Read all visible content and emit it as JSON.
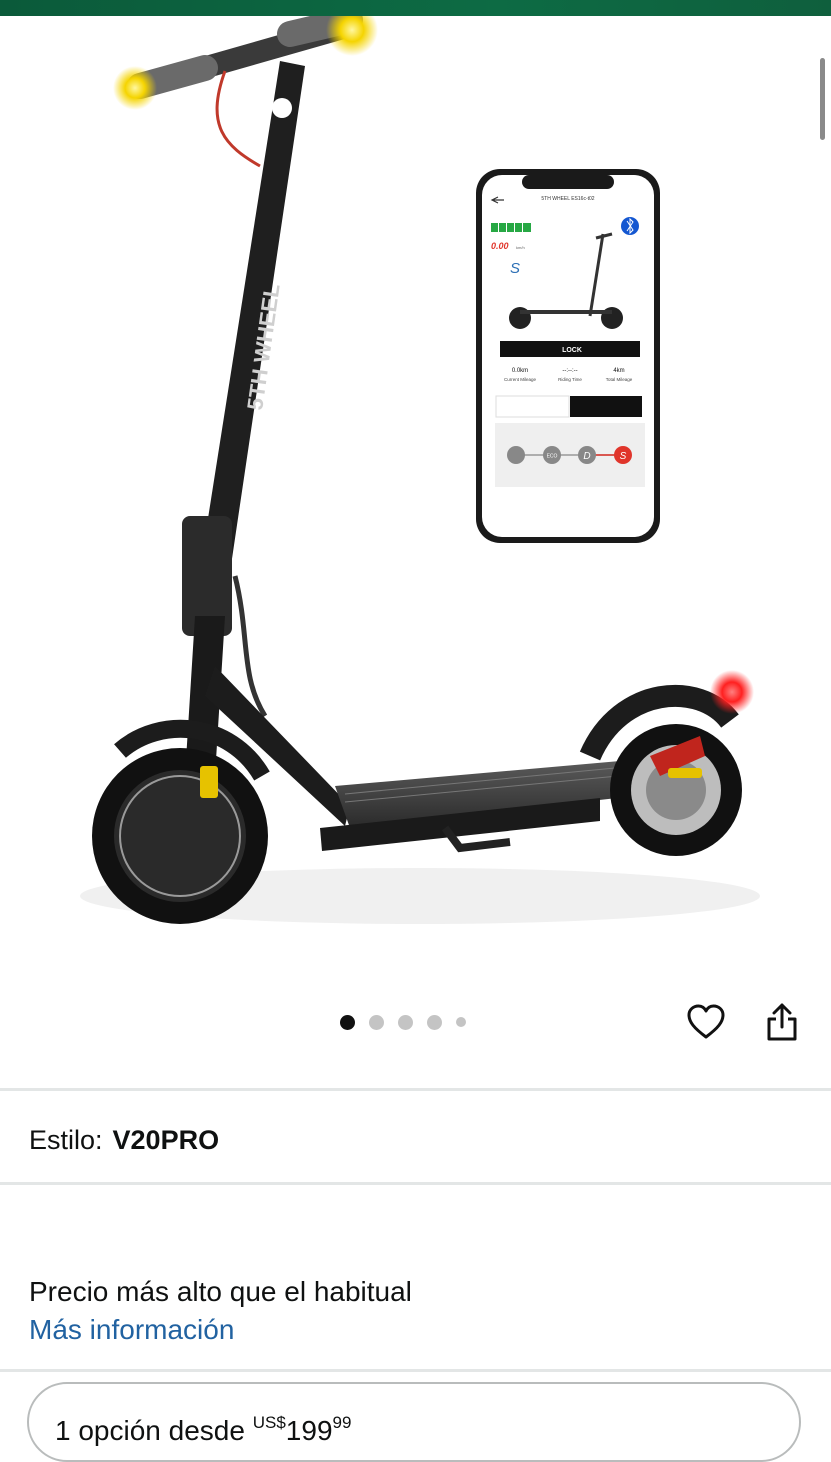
{
  "product": {
    "image_alt": "5TH WHEEL electric scooter with app",
    "brand_on_stem": "5TH WHEEL",
    "phone_app": {
      "title": "5TH WHEEL ES16c-t02",
      "speed": "0.00",
      "speed_unit": "km/h",
      "mode_letter": "S",
      "lock_label": "LOCK",
      "current_mileage_value": "0.0km",
      "current_mileage_label": "Current Mileage",
      "riding_time_value": "--:--:--",
      "riding_time_label": "Riding Time",
      "total_mileage_value": "4km",
      "total_mileage_label": "Total Mileage",
      "modes": [
        "ECO",
        "D",
        "S"
      ]
    }
  },
  "carousel": {
    "count": 5,
    "active_index": 0
  },
  "actions": {
    "favorite_icon": "heart-icon",
    "share_icon": "share-icon"
  },
  "style": {
    "label": "Estilo:",
    "value": "V20PRO"
  },
  "pricing": {
    "note": "Precio más alto que el habitual",
    "more_info": "Más información",
    "option_prefix": "1 opción desde ",
    "currency": "US$",
    "whole": "199",
    "cents": "99"
  },
  "colors": {
    "topbar": "#0d6b44",
    "link": "#2162a1",
    "mode_active": "#e0352b",
    "battery": "#27a844"
  }
}
